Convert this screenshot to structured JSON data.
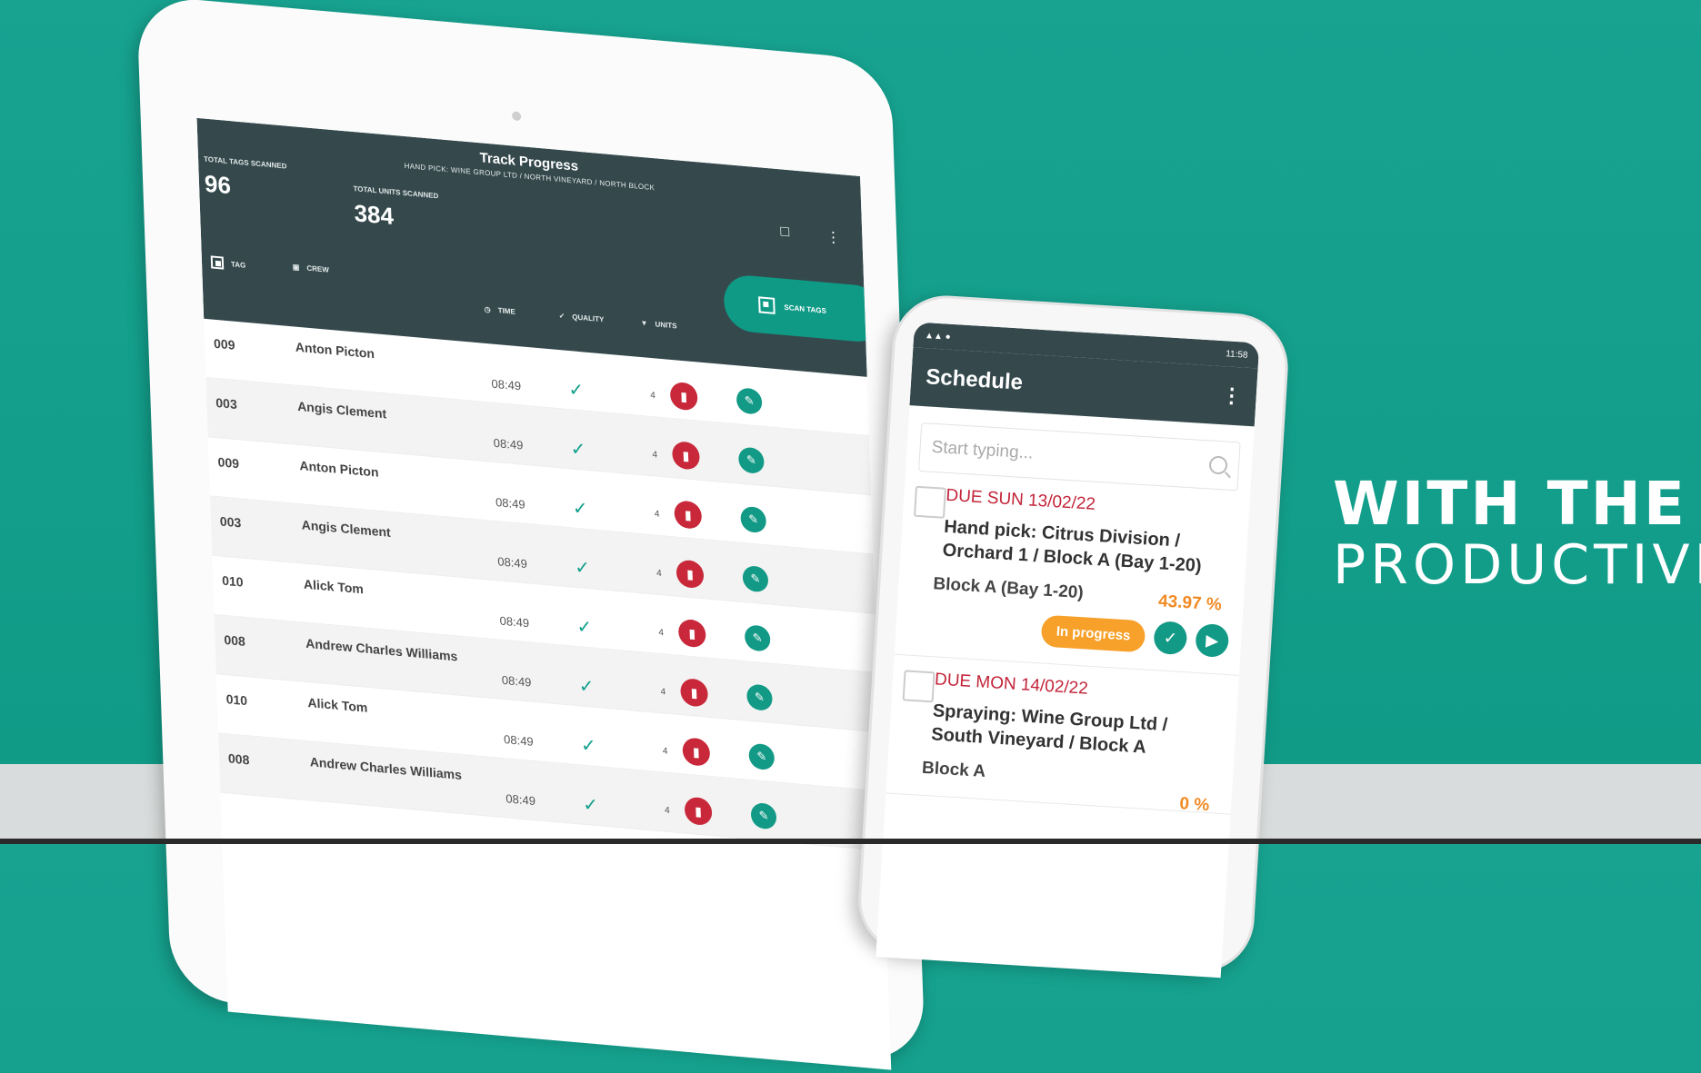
{
  "headline": {
    "line1": "WITH THE A",
    "line2": "PRODUCTIVI"
  },
  "tablet": {
    "title": "Track Progress",
    "subtitle": "HAND PICK: WINE GROUP LTD / NORTH VINEYARD / NORTH BLOCK",
    "total_tags_label": "TOTAL TAGS SCANNED",
    "total_tags_value": "96",
    "total_units_label": "TOTAL UNITS SCANNED",
    "total_units_value": "384",
    "scan_button_label": "SCAN TAGS",
    "columns": {
      "tag": "TAG",
      "crew": "CREW",
      "time": "TIME",
      "quality": "QUALITY",
      "units": "UNITS"
    },
    "rows": [
      {
        "tag": "009",
        "crew": "Anton Picton",
        "time": "08:49",
        "units": "4"
      },
      {
        "tag": "003",
        "crew": "Angis Clement",
        "time": "08:49",
        "units": "4"
      },
      {
        "tag": "009",
        "crew": "Anton Picton",
        "time": "08:49",
        "units": "4"
      },
      {
        "tag": "003",
        "crew": "Angis Clement",
        "time": "08:49",
        "units": "4"
      },
      {
        "tag": "010",
        "crew": "Alick Tom",
        "time": "08:49",
        "units": "4"
      },
      {
        "tag": "008",
        "crew": "Andrew Charles Williams",
        "time": "08:49",
        "units": "4"
      },
      {
        "tag": "010",
        "crew": "Alick Tom",
        "time": "08:49",
        "units": "4"
      },
      {
        "tag": "008",
        "crew": "Andrew Charles Williams",
        "time": "08:49",
        "units": "4"
      }
    ]
  },
  "phone": {
    "status_time": "11:58",
    "title": "Schedule",
    "search_placeholder": "Start typing...",
    "cards": [
      {
        "due": "DUE SUN 13/02/22",
        "name": "Hand pick: Citrus Division / Orchard 1 / Block A (Bay 1-20)",
        "block": "Block A (Bay 1-20)",
        "percent": "43.97 %",
        "status": "In progress"
      },
      {
        "due": "DUE MON 14/02/22",
        "name": "Spraying: Wine Group Ltd / South Vineyard / Block A",
        "block": "Block A",
        "percent": "0 %"
      }
    ]
  },
  "colors": {
    "teal": "#129a86",
    "dark": "#35494d",
    "red": "#c8283a",
    "orange": "#f7a12a"
  }
}
